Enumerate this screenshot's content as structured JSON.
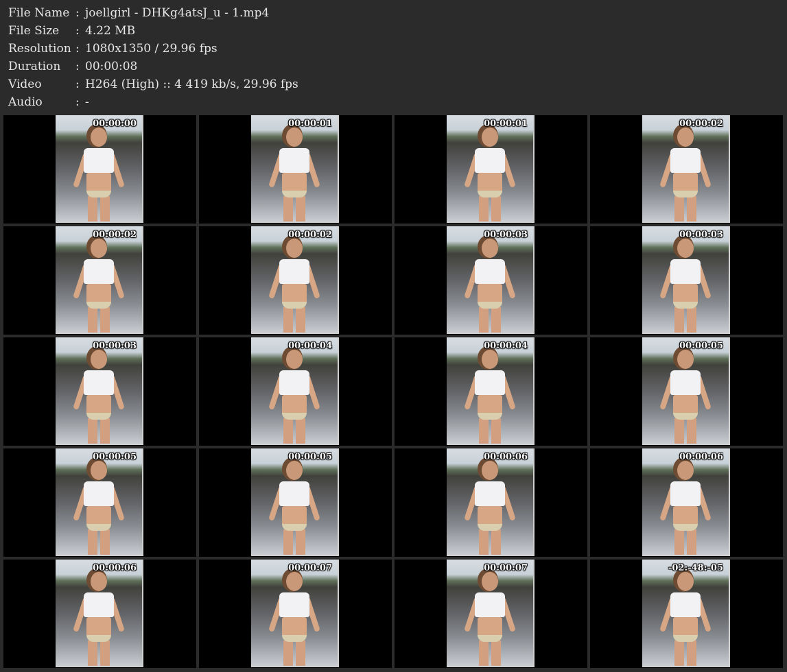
{
  "info": [
    {
      "key": "File Name",
      "sep": ":",
      "value": "joellgirl - DHKg4atsJ_u - 1.mp4"
    },
    {
      "key": "File Size",
      "sep": ":",
      "value": "4.22 MB"
    },
    {
      "key": "Resolution",
      "sep": ":",
      "value": "1080x1350 / 29.96 fps"
    },
    {
      "key": "Duration",
      "sep": ":",
      "value": "00:00:08"
    },
    {
      "key": "Video",
      "sep": ":",
      "value": "H264 (High) :: 4 419 kb/s, 29.96 fps"
    },
    {
      "key": "Audio",
      "sep": ":",
      "value": "-"
    }
  ],
  "thumbnails": [
    {
      "timestamp": "00:00:00"
    },
    {
      "timestamp": "00:00:01"
    },
    {
      "timestamp": "00:00:01"
    },
    {
      "timestamp": "00:00:02"
    },
    {
      "timestamp": "00:00:02"
    },
    {
      "timestamp": "00:00:02"
    },
    {
      "timestamp": "00:00:03"
    },
    {
      "timestamp": "00:00:03"
    },
    {
      "timestamp": "00:00:03"
    },
    {
      "timestamp": "00:00:04"
    },
    {
      "timestamp": "00:00:04"
    },
    {
      "timestamp": "00:00:05"
    },
    {
      "timestamp": "00:00:05"
    },
    {
      "timestamp": "00:00:05"
    },
    {
      "timestamp": "00:00:06"
    },
    {
      "timestamp": "00:00:06"
    },
    {
      "timestamp": "00:00:06"
    },
    {
      "timestamp": "00:00:07"
    },
    {
      "timestamp": "00:00:07"
    },
    {
      "timestamp": "-02:-48:-05"
    }
  ]
}
